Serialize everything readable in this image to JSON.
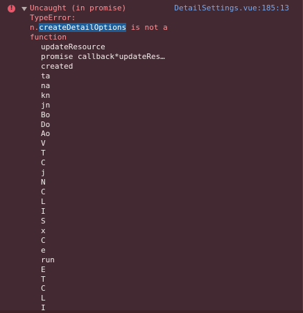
{
  "message": {
    "type_label": "Uncaught (in promise)",
    "error_name": "TypeError:",
    "line3_prefix": "n.",
    "highlighted_term": "createDetailOptions",
    "line3_suffix": " is not a",
    "line4": "function"
  },
  "source": {
    "link": "DetailSettings.vue:185:13"
  },
  "icons": {
    "error": "error-circle-icon",
    "disclosure": "triangle-down-icon",
    "error_glyph": "!"
  },
  "colors": {
    "background": "#432931",
    "error_text": "#ff8f96",
    "link": "#7ca7e8",
    "highlight": "#1e5d97"
  },
  "stack_frames": [
    "updateResource",
    "promise callback*updateRes…",
    "created",
    "ta",
    "na",
    "kn",
    "jn",
    "Bo",
    "Do",
    "Ao",
    "V",
    "T",
    "C",
    "j",
    "N",
    "C",
    "L",
    "I",
    "S",
    "x",
    "C",
    "e",
    "run",
    "E",
    "T",
    "C",
    "L",
    "I"
  ]
}
